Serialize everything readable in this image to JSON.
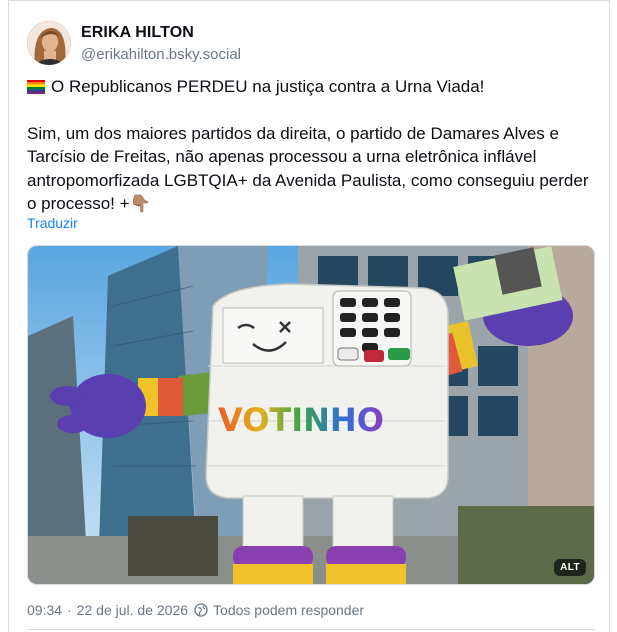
{
  "author": {
    "display_name": "ERIKA HILTON",
    "handle": "@erikahilton.bsky.social"
  },
  "post": {
    "flag_icon": "rainbow-flag-icon",
    "paragraph1": "O Republicanos PERDEU na justiça contra a Urna Viada!",
    "paragraph2": "Sim, um dos maiores partidos da direita, o partido de Damares Alves e Tarcísio de Freitas, não apenas processou a urna eletrônica inflável antropomorfizada LGBTQIA+ da Avenida Paulista, como conseguiu perder o processo! +",
    "trailing_emoji": "👇🏽",
    "translate_label": "Traduzir"
  },
  "media": {
    "balloon_text": "VOTINHO",
    "alt_badge": "ALT"
  },
  "meta": {
    "time": "09:34",
    "separator": "·",
    "date": "22 de jul. de 2026",
    "reply_setting": "Todos podem responder"
  },
  "colors": {
    "link": "#1083fe",
    "secondary_text": "#6b7785",
    "border": "#d4dbe2"
  }
}
